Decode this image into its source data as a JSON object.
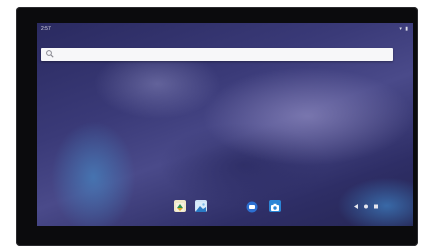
{
  "status_bar": {
    "time": "2:57",
    "icons": "▾ ▮"
  },
  "search": {
    "placeholder": ""
  },
  "dock": {
    "apps": [
      {
        "name": "files-app",
        "icon": "folder-icon"
      },
      {
        "name": "gallery-app",
        "icon": "image-icon"
      },
      {
        "name": "messages-app",
        "icon": "chat-icon"
      },
      {
        "name": "camera-app",
        "icon": "camera-icon"
      }
    ]
  },
  "navigation": {
    "buttons": [
      "back-icon",
      "home-icon",
      "recents-icon"
    ]
  },
  "colors": {
    "device": "#0b0b0d",
    "wallpaper_dark": "#2a2a60",
    "wallpaper_accent": "#4a86c0",
    "search_bar": "#f7f7f9"
  }
}
